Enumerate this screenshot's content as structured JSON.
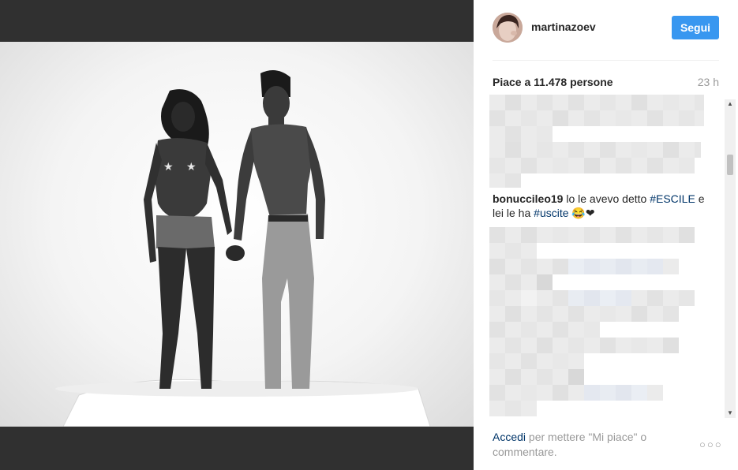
{
  "post": {
    "username": "martinazoev",
    "follow_label": "Segui"
  },
  "likes": {
    "prefix": "Piace a",
    "count": "11.478",
    "suffix": "persone",
    "time": "23 h"
  },
  "comment": {
    "author": "bonuccileo19",
    "text1": " lo le avevo detto ",
    "tag1": "#ESCILE",
    "text2": " e lei le ha ",
    "tag2": "#uscite",
    "emoji": " 😂❤"
  },
  "footer": {
    "login_label": "Accedi",
    "text": " per mettere \"Mi piace\" o commentare."
  },
  "icons": {
    "more": "more-options-icon",
    "scroll_up": "scroll-up-arrow-icon",
    "scroll_down": "scroll-down-arrow-icon"
  },
  "colors": {
    "accent": "#3897f0",
    "link": "#003569",
    "muted": "#999999",
    "dark_bg": "#303030"
  }
}
